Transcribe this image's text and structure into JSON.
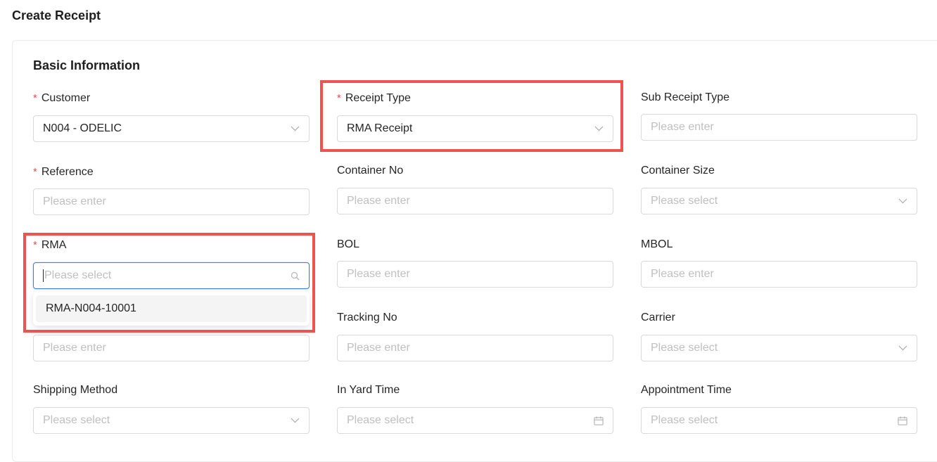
{
  "page": {
    "title": "Create Receipt"
  },
  "section": {
    "title": "Basic Information"
  },
  "fields": {
    "customer": {
      "label": "Customer",
      "value": "N004 - ODELIC"
    },
    "receipt_type": {
      "label": "Receipt Type",
      "value": "RMA Receipt"
    },
    "sub_receipt_type": {
      "label": "Sub Receipt Type",
      "placeholder": "Please enter"
    },
    "reference": {
      "label": "Reference",
      "placeholder": "Please enter"
    },
    "container_no": {
      "label": "Container No",
      "placeholder": "Please enter"
    },
    "container_size": {
      "label": "Container Size",
      "placeholder": "Please select"
    },
    "rma": {
      "label": "RMA",
      "placeholder": "Please select",
      "options": [
        "RMA-N004-10001"
      ]
    },
    "bol": {
      "label": "BOL",
      "placeholder": "Please enter"
    },
    "mbol": {
      "label": "MBOL",
      "placeholder": "Please enter"
    },
    "hidden_row4": {
      "placeholder": "Please enter"
    },
    "tracking_no": {
      "label": "Tracking No",
      "placeholder": "Please enter"
    },
    "carrier": {
      "label": "Carrier",
      "placeholder": "Please select"
    },
    "shipping_method": {
      "label": "Shipping Method",
      "placeholder": "Please select"
    },
    "in_yard_time": {
      "label": "In Yard Time",
      "placeholder": "Please select"
    },
    "appointment_time": {
      "label": "Appointment Time",
      "placeholder": "Please select"
    }
  },
  "required_mark": "*",
  "icons": {
    "select": "chevron-down-icon",
    "search": "search-icon",
    "date": "calendar-icon"
  },
  "colors": {
    "required": "#e34d59",
    "focus": "#3b7cff",
    "highlight": "#ef5350"
  }
}
